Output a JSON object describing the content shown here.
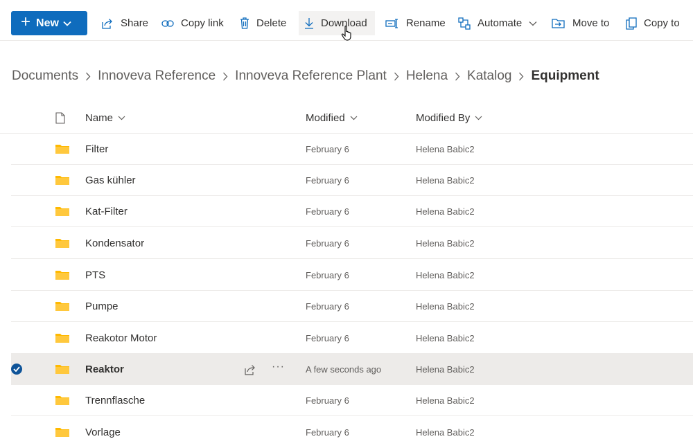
{
  "toolbar": {
    "new_label": "New",
    "share_label": "Share",
    "copylink_label": "Copy link",
    "delete_label": "Delete",
    "download_label": "Download",
    "rename_label": "Rename",
    "automate_label": "Automate",
    "moveto_label": "Move to",
    "copyto_label": "Copy to"
  },
  "breadcrumb": {
    "items": [
      "Documents",
      "Innoveva Reference",
      "Innoveva Reference Plant",
      "Helena",
      "Katalog"
    ],
    "current": "Equipment"
  },
  "columns": {
    "name": "Name",
    "modified": "Modified",
    "modified_by": "Modified By"
  },
  "rows": [
    {
      "name": "Filter",
      "modified": "February 6",
      "modified_by": "Helena Babic2"
    },
    {
      "name": "Gas kühler",
      "modified": "February 6",
      "modified_by": "Helena Babic2"
    },
    {
      "name": "Kat-Filter",
      "modified": "February 6",
      "modified_by": "Helena Babic2"
    },
    {
      "name": "Kondensator",
      "modified": "February 6",
      "modified_by": "Helena Babic2"
    },
    {
      "name": "PTS",
      "modified": "February 6",
      "modified_by": "Helena Babic2"
    },
    {
      "name": "Pumpe",
      "modified": "February 6",
      "modified_by": "Helena Babic2"
    },
    {
      "name": "Reakotor Motor",
      "modified": "February 6",
      "modified_by": "Helena Babic2"
    },
    {
      "name": "Reaktor",
      "modified": "A few seconds ago",
      "modified_by": "Helena Babic2",
      "selected": true
    },
    {
      "name": "Trennflasche",
      "modified": "February 6",
      "modified_by": "Helena Babic2"
    },
    {
      "name": "Vorlage",
      "modified": "February 6",
      "modified_by": "Helena Babic2"
    }
  ],
  "colors": {
    "accent": "#0f6cbd",
    "folder": "#ffb900",
    "selected_row": "#edebe9"
  }
}
